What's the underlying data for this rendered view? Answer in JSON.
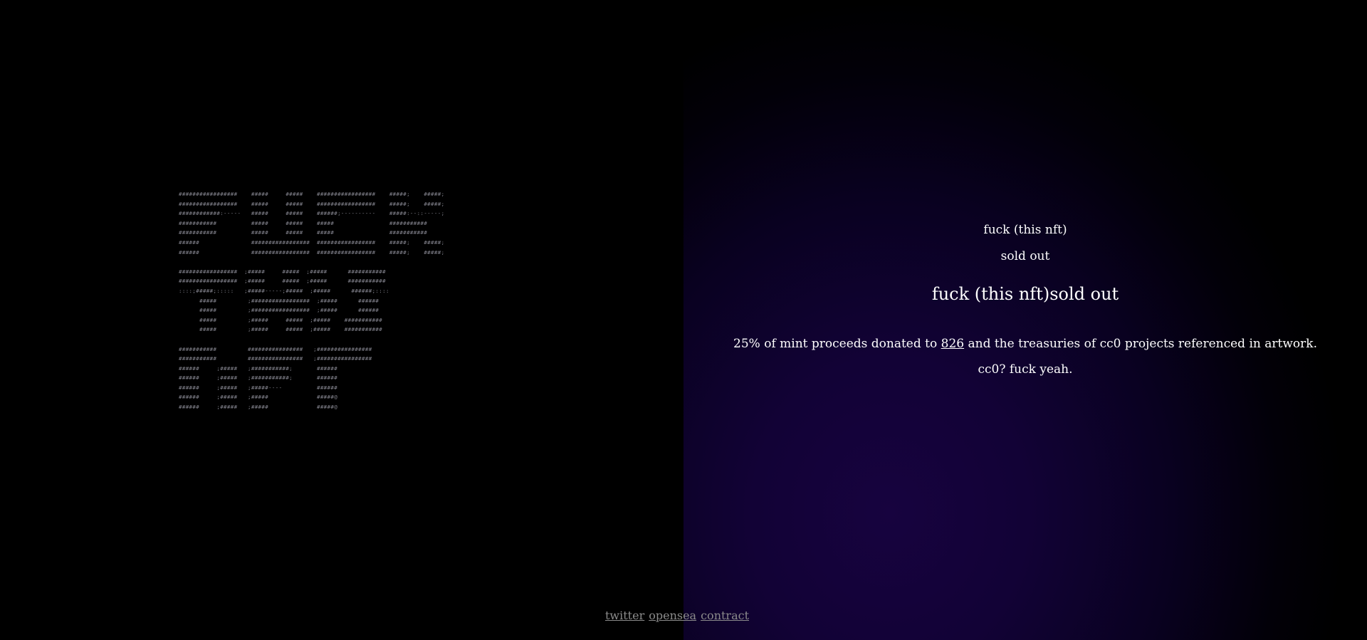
{
  "ascii": {
    "lines": [
      "#################    #####     #####    #################    #####;    #####;",
      "#################    #####     #####    #################    #####;    #####;",
      "############:-----   #####     #####    ######;----------    #####:--::-----;",
      "###########          #####     #####    #####                ###########     ",
      "###########          #####     #####    #####                ###########     ",
      "######               #################  #################    #####;    #####;",
      "######               #################  #################    #####;    #####;",
      "",
      "#################  ;#####     #####  ;#####      ###########",
      "#################  ;#####     #####  ;#####      ###########",
      "::::;#####;:::::   ;#####-----;#####  ;#####      ######;::::",
      "      #####         ;#################  ;#####      ######     ",
      "      #####         ;#################  ;#####      ######     ",
      "      #####         ;#####     #####  ;#####    ###########    ",
      "      #####         ;#####     #####  ;#####    ###########    ",
      "",
      "###########         ################   ;################",
      "###########         ################   ;################",
      "######     ;#####   ;###########;       ######          ",
      "######     ;#####   ;###########;       ######          ",
      "######     ;#####   ;#####----          ######          ",
      "######     ;#####   ;#####              #####@          ",
      "######     ;#####   ;#####              #####@          "
    ]
  },
  "info": {
    "name": "fuck (this nft)",
    "status": "sold out",
    "heading": "fuck (this nft)sold out",
    "donation_prefix": "25% of mint proceeds donated to ",
    "donation_link": "826",
    "donation_suffix": " and the treasuries of cc0 projects referenced in artwork.",
    "motto": "cc0? fuck yeah."
  },
  "footer": {
    "links": [
      "twitter",
      "opensea",
      "contract"
    ]
  },
  "colors": {
    "background": "#000000",
    "gradient_accent": "#17033f",
    "text": "#ffffff",
    "footer_link": "#8b8b8b",
    "ascii": "#9a9aa6"
  }
}
